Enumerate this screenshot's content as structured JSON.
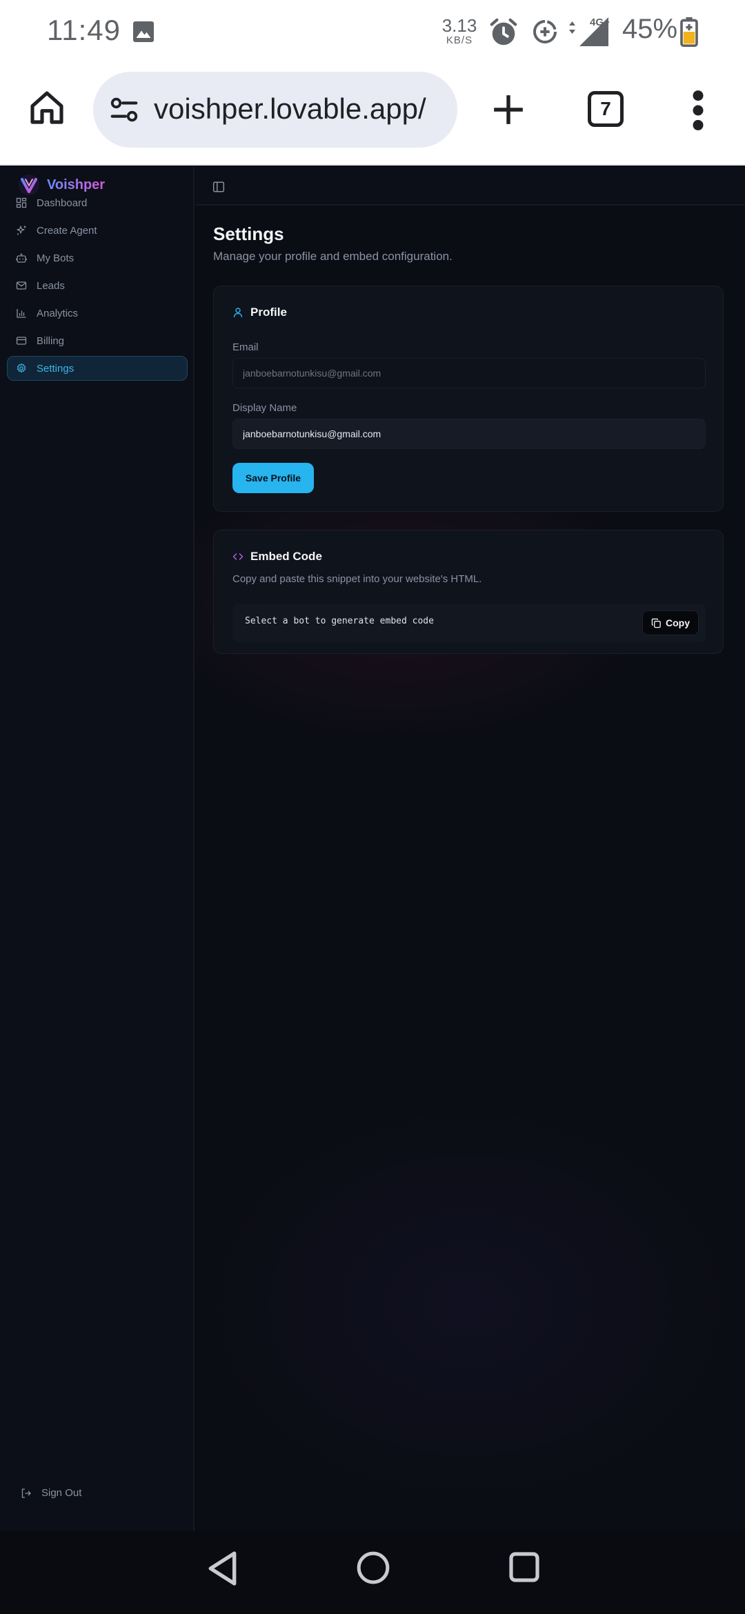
{
  "status_bar": {
    "time": "11:49",
    "net_speed_value": "3.13",
    "net_speed_unit": "KB/S",
    "network": "4G+",
    "battery": "45%"
  },
  "browser": {
    "url": "voishper.lovable.app/",
    "tab_count": "7"
  },
  "app": {
    "brand": "Voishper",
    "nav": [
      {
        "label": "Dashboard",
        "icon": "dashboard-icon"
      },
      {
        "label": "Create Agent",
        "icon": "sparkles-icon"
      },
      {
        "label": "My Bots",
        "icon": "bot-icon"
      },
      {
        "label": "Leads",
        "icon": "mail-icon"
      },
      {
        "label": "Analytics",
        "icon": "bar-chart-icon"
      },
      {
        "label": "Billing",
        "icon": "credit-card-icon"
      },
      {
        "label": "Settings",
        "icon": "gear-icon",
        "active": true
      }
    ],
    "sign_out": "Sign Out"
  },
  "page": {
    "title": "Settings",
    "subtitle": "Manage your profile and embed configuration."
  },
  "profile": {
    "heading": "Profile",
    "email_label": "Email",
    "email_value": "janboebarnotunkisu@gmail.com",
    "display_name_label": "Display Name",
    "display_name_value": "janboebarnotunkisu@gmail.com",
    "save_label": "Save Profile"
  },
  "embed": {
    "heading": "Embed Code",
    "description": "Copy and paste this snippet into your website's HTML.",
    "code": "Select a bot to generate embed code",
    "copy_label": "Copy"
  },
  "colors": {
    "accent": "#27b4ef",
    "background": "#0b0d14",
    "card": "#0f131c",
    "brand_gradient_start": "#6b8dff",
    "brand_gradient_end": "#d35bd8"
  }
}
